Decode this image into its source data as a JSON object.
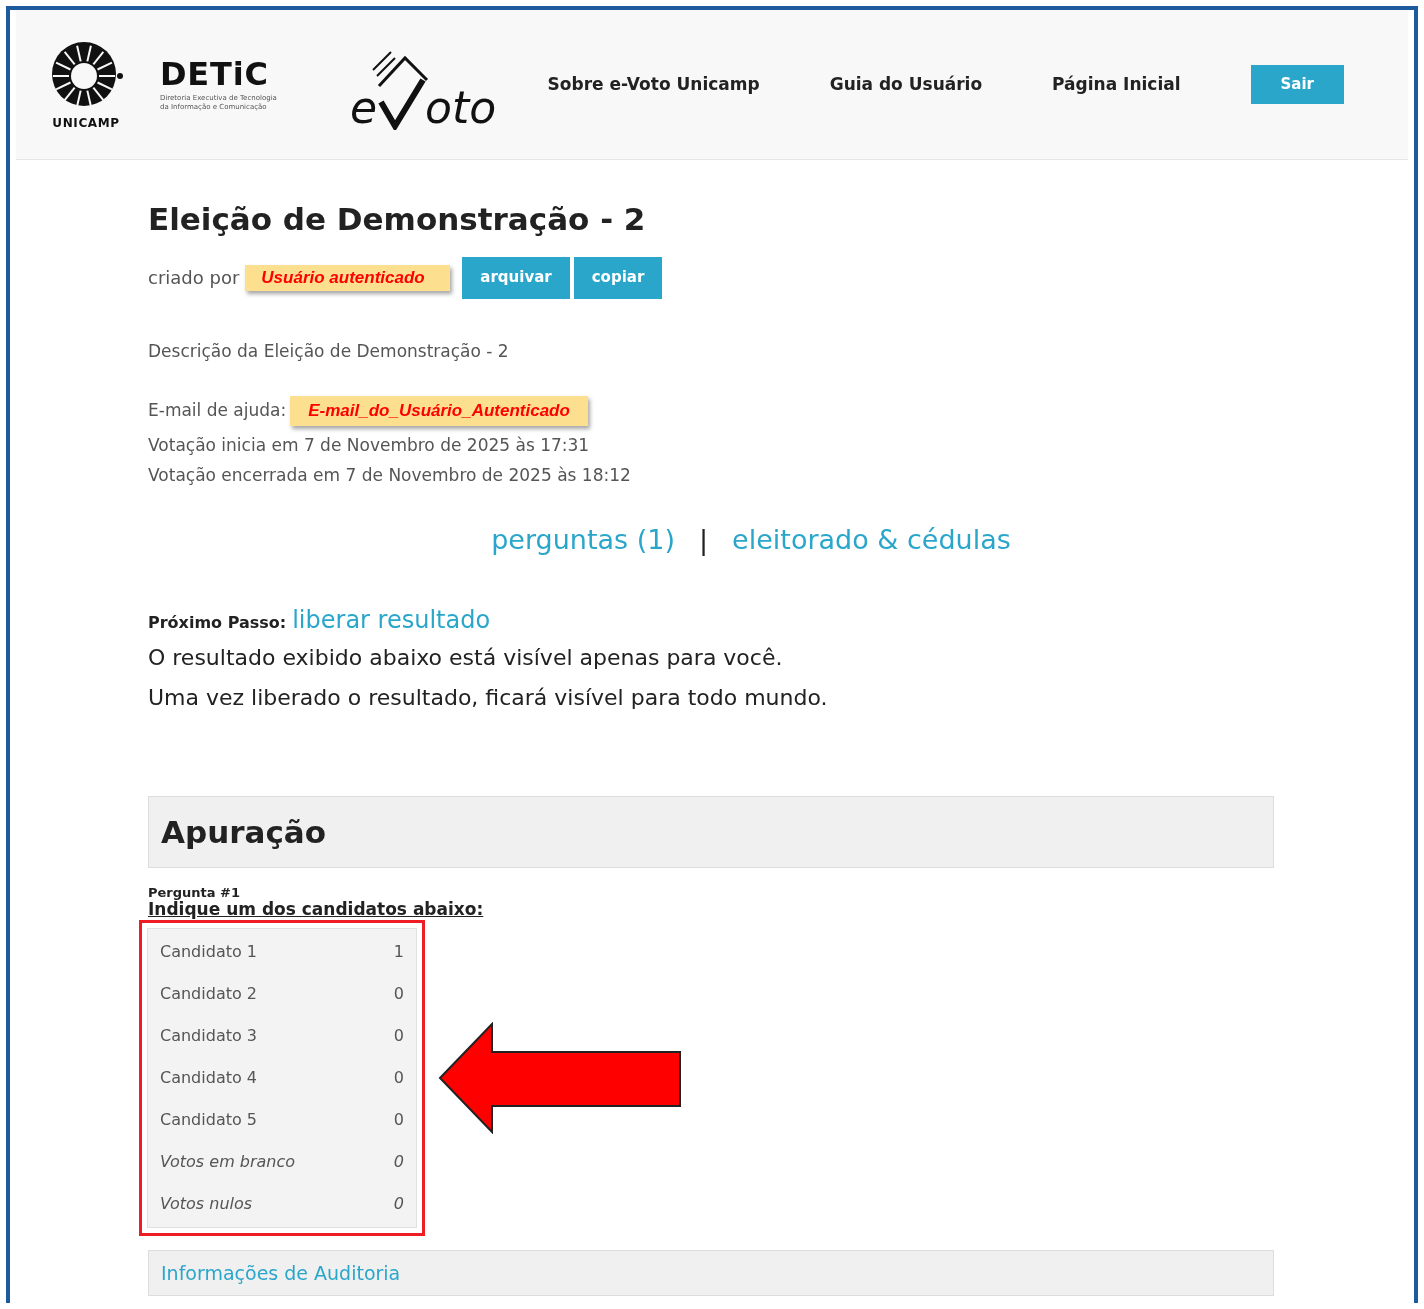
{
  "header": {
    "logos": {
      "unicamp": "UNICAMP",
      "detic": "DETiC",
      "detic_subtitle": "Diretoria Executiva de Tecnologia da Informação e Comunicação",
      "evoto_prefix": "e",
      "evoto_suffix": "oto"
    },
    "nav": [
      {
        "label": "Sobre e-Voto Unicamp",
        "kind": "link"
      },
      {
        "label": "Guia do Usuário",
        "kind": "link"
      },
      {
        "label": "Página Inicial",
        "kind": "link"
      },
      {
        "label": "Sair",
        "kind": "button"
      }
    ]
  },
  "election": {
    "title": "Eleição de Demonstração - 2",
    "created_by_label": "criado por",
    "created_by": "Usuário autenticado",
    "actions": [
      "arquivar",
      "copiar"
    ],
    "description": "Descrição da Eleição de Demonstração - 2",
    "help_email_label": "E-mail de ajuda:",
    "help_email": "E-mail_do_Usuário_Autenticado",
    "start": "Votação inicia em 7 de Novembro de 2025 às 17:31",
    "end": "Votação encerrada em 7 de Novembro de 2025 às 18:12"
  },
  "links": [
    "perguntas (1)",
    "eleitorado & cédulas"
  ],
  "links_separator": "|",
  "next_step": {
    "label": "Próximo Passo:",
    "link": "liberar resultado",
    "notes": [
      "O resultado exibido abaixo está visível apenas para você.",
      "Uma vez liberado o resultado, ficará visível para todo mundo."
    ]
  },
  "tally": {
    "title": "Apuração",
    "question_label": "Pergunta #1",
    "question": "Indique um dos candidatos abaixo:",
    "rows": [
      {
        "name": "Candidato 1",
        "votes": "1",
        "kind": "candidate"
      },
      {
        "name": "Candidato 2",
        "votes": "0",
        "kind": "candidate"
      },
      {
        "name": "Candidato 3",
        "votes": "0",
        "kind": "candidate"
      },
      {
        "name": "Candidato 4",
        "votes": "0",
        "kind": "candidate"
      },
      {
        "name": "Candidato 5",
        "votes": "0",
        "kind": "candidate"
      },
      {
        "name": "Votos em branco",
        "votes": "0",
        "kind": "special"
      },
      {
        "name": "Votos nulos",
        "votes": "0",
        "kind": "special"
      }
    ],
    "audit": "Informações de Auditoria"
  }
}
